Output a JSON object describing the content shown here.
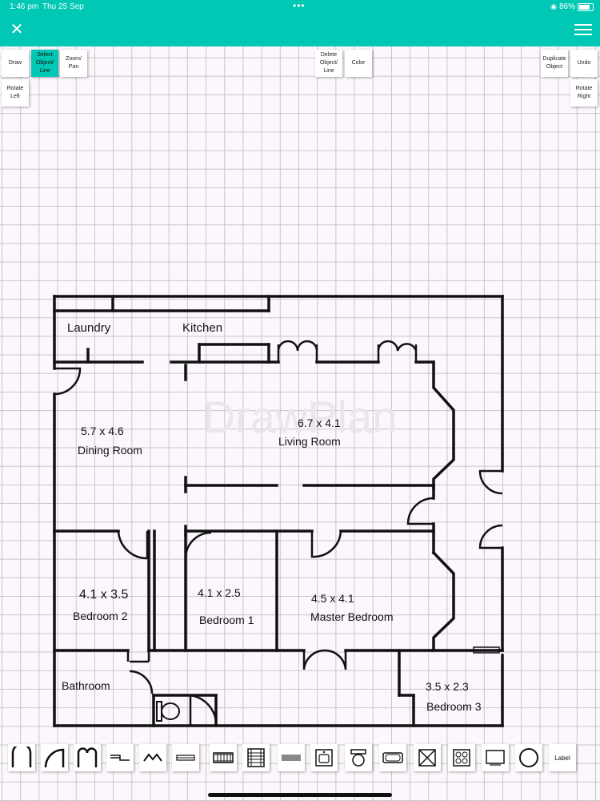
{
  "status_bar": {
    "time": "1:46 pm",
    "date": "Thu 25 Sep",
    "battery": "86%"
  },
  "toolbar": {
    "draw": "Draw",
    "select": "Select Object/ Line",
    "zoom_pan": "Zoom/ Pan",
    "rotate_left": "Rotate Left",
    "delete": "Delete Object/ Line",
    "color": "Color",
    "duplicate": "Duplicate Object",
    "undo": "Undo",
    "rotate_right": "Rotate Right"
  },
  "accent_color": "#00c8b4",
  "watermark": "DrawPlan",
  "rooms": {
    "laundry": "Laundry",
    "kitchen": "Kitchen",
    "dining_dim": "5.7 x 4.6",
    "dining": "Dining Room",
    "living_dim": "6.7 x 4.1",
    "living": "Living Room",
    "bed2_dim": "4.1 x 3.5",
    "bed2": "Bedroom 2",
    "bed1_dim": "4.1 x 2.5",
    "bed1": "Bedroom 1",
    "master_dim": "4.5 x 4.1",
    "master": "Master Bedroom",
    "bathroom": "Bathroom",
    "bed3_dim": "3.5 x 2.3",
    "bed3": "Bedroom 3"
  },
  "palette": {
    "label": "Label",
    "icons": [
      "door-single-icon",
      "door-curved-icon",
      "door-double-icon",
      "step-icon",
      "roof-icon",
      "window-icon",
      "stairs-icon",
      "stairs-vertical-icon",
      "solid-block-icon",
      "sink-icon",
      "toilet-icon",
      "bath-icon",
      "cross-box-icon",
      "stove-icon",
      "tv-icon",
      "circle-icon"
    ]
  }
}
